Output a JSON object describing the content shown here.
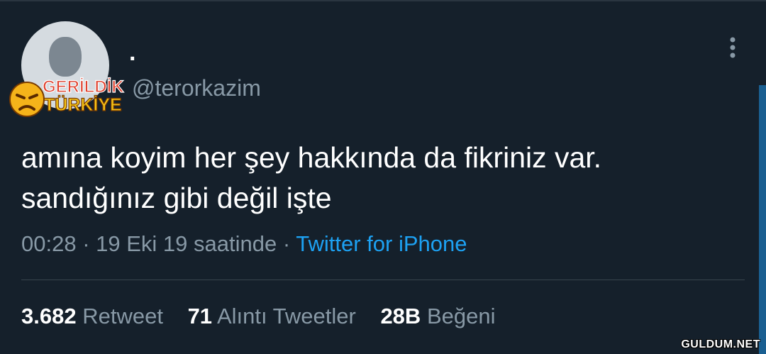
{
  "tweet": {
    "display_name": ".",
    "handle": "@terorkazim",
    "text_line1": "amına koyim her şey hakkında da fikriniz var.",
    "text_line2": "sandığınız gibi değil işte",
    "time": "00:28",
    "date": "19 Eki 19 saatinde",
    "separator": "·",
    "source": "Twitter for iPhone",
    "retweets": "3.682",
    "retweets_label": "Retweet",
    "quotes": "71",
    "quotes_label": "Alıntı Tweetler",
    "likes": "28B",
    "likes_label": "Beğeni"
  },
  "watermarks": {
    "top_line1": "GERİLDİK",
    "top_line2": "TÜRKİYE",
    "bottom": "GULDUM.NET"
  },
  "icons": {
    "avatar": "avatar-placeholder",
    "more": "more-vertical-icon",
    "watermark_face": "angry-face-icon"
  },
  "colors": {
    "background": "#15202b",
    "secondary_text": "#8899a6",
    "link": "#1da1f2",
    "divider": "#38444d"
  }
}
